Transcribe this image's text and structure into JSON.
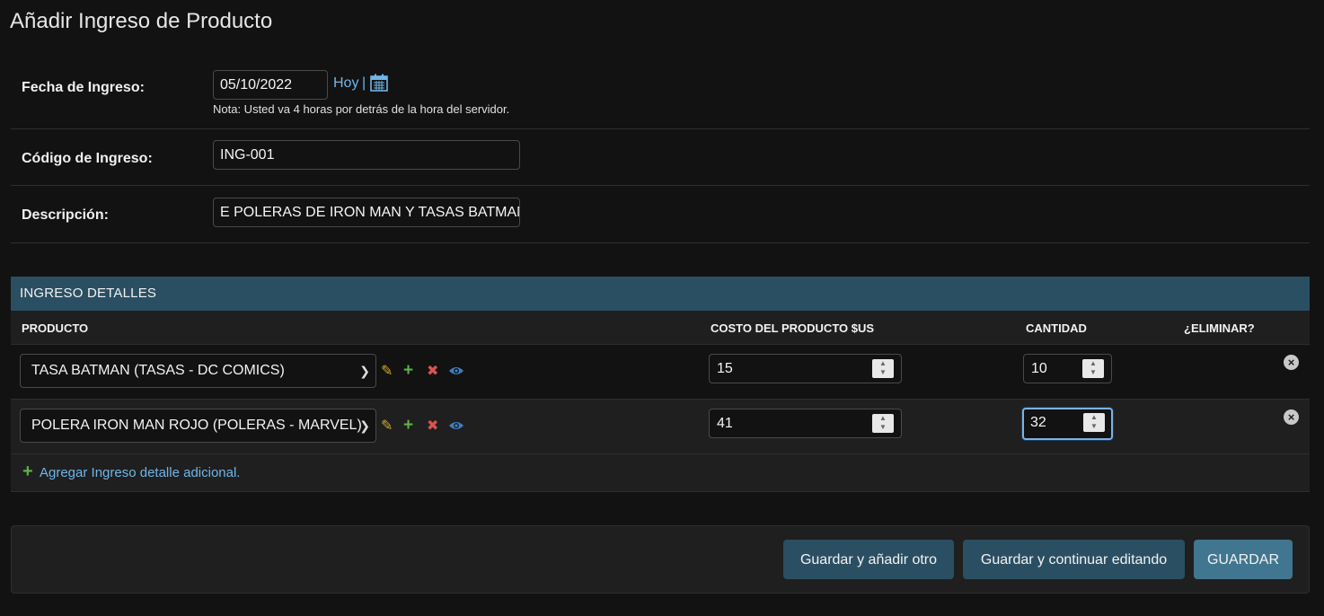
{
  "page": {
    "title": "Añadir Ingreso de Producto"
  },
  "fecha": {
    "label": "Fecha de Ingreso:",
    "value": "05/10/2022",
    "today_link": "Hoy",
    "separator": "|",
    "calendar_icon": "calendar-icon",
    "note": "Nota: Usted va 4 horas por detrás de la hora del servidor."
  },
  "codigo": {
    "label": "Código de Ingreso:",
    "value": "ING-001"
  },
  "descripcion": {
    "label": "Descripción:",
    "value": "E POLERAS DE IRON MAN Y TASAS BATMAN"
  },
  "detalles": {
    "title": "INGRESO DETALLES",
    "columns": {
      "producto": "PRODUCTO",
      "costo": "COSTO DEL PRODUCTO $US",
      "cantidad": "CANTIDAD",
      "eliminar": "¿ELIMINAR?"
    },
    "rows": [
      {
        "producto": "TASA BATMAN (TASAS - DC COMICS)",
        "costo": "15",
        "cantidad": "10"
      },
      {
        "producto": "POLERA IRON MAN ROJO (POLERAS - MARVEL)",
        "costo": "41",
        "cantidad": "32"
      }
    ],
    "row_icons": {
      "edit": "pencil-icon",
      "add": "plus-icon",
      "delete": "x-icon",
      "view": "eye-icon"
    },
    "add_link": "Agregar Ingreso detalle adicional."
  },
  "buttons": {
    "save_add": "Guardar y añadir otro",
    "save_continue": "Guardar y continuar editando",
    "save": "GUARDAR"
  },
  "colors": {
    "background": "#121212",
    "module_header": "#2a4f63",
    "primary_button": "#417690",
    "link": "#6fb6e8",
    "edit_icon": "#d4a92a",
    "add_icon": "#5fb04a",
    "delete_icon": "#d9534f",
    "view_icon": "#3f7fc0"
  }
}
